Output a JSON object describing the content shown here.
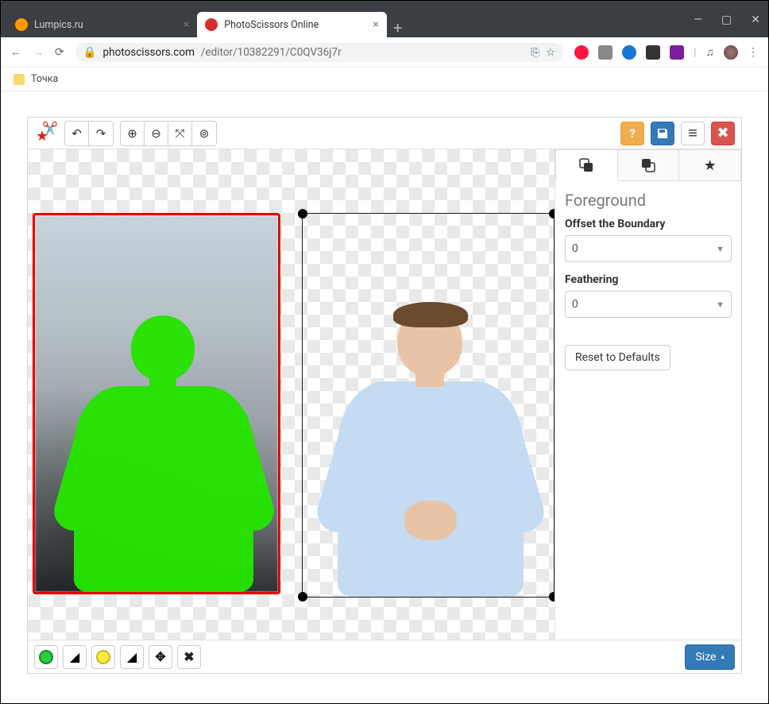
{
  "browser": {
    "tabs": [
      {
        "title": "Lumpics.ru",
        "favicon_color": "#ff9800",
        "active": false
      },
      {
        "title": "PhotoScissors Online",
        "favicon_color": "#d32f2f",
        "active": true
      }
    ],
    "nav_icons": {
      "back": "←",
      "forward": "→",
      "reload": "⟳"
    },
    "omnibox": {
      "lock_icon": "lock-icon",
      "domain": "photoscissors.com",
      "path": "/editor/10382291/C0QV36j7r",
      "translate_icon": "translate-icon",
      "star_icon": "star-icon"
    },
    "extensions": [
      {
        "name": "opera-ext",
        "color": "#ff1744"
      },
      {
        "name": "lastfm-ext",
        "color": "#777"
      },
      {
        "name": "globe-ext",
        "color": "#1976d2"
      },
      {
        "name": "box-ext",
        "color": "#333"
      },
      {
        "name": "adblock-ext",
        "color": "#7b1fa2"
      }
    ],
    "right_icons": {
      "playlist": "playlist-icon",
      "avatar": "avatar-icon",
      "menu": "kebab-icon"
    },
    "bookmarks": [
      {
        "label": "Точка"
      }
    ],
    "window_controls": {
      "min": "—",
      "max": "▢",
      "close": "✕"
    }
  },
  "app": {
    "toolbar": {
      "logo": "scissors-star-logo",
      "undo": "↶",
      "redo": "↷",
      "zoom_in": "⊕",
      "zoom_out": "⊖",
      "zoom_fit": "⤧",
      "zoom_reset": "⊚",
      "help": "?",
      "save": "💾",
      "menu": "≡",
      "close": "✖"
    },
    "panel": {
      "tabs": {
        "fg": "foreground-tab",
        "bg": "background-tab",
        "fav": "favorite-tab"
      },
      "heading": "Foreground",
      "offset_label": "Offset the Boundary",
      "offset_value": "0",
      "feather_label": "Feathering",
      "feather_value": "0",
      "reset": "Reset to Defaults"
    },
    "bottombar": {
      "add_fg": "add-foreground-marker",
      "erase_fg": "erase-foreground-marker",
      "add_bg": "add-background-marker",
      "erase_bg": "erase-background-marker",
      "move": "✥",
      "delete": "✖",
      "size_label": "Size",
      "size_caret": "▴"
    }
  }
}
